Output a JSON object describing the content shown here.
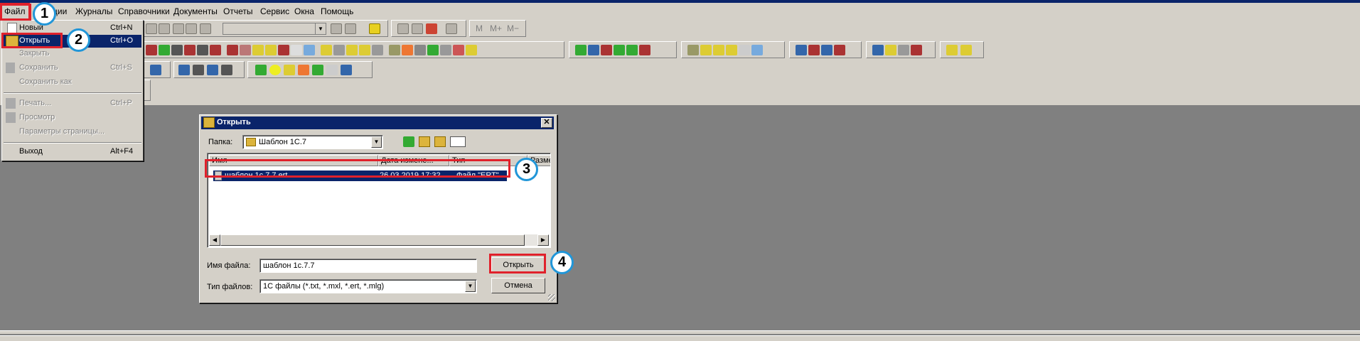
{
  "menubar": {
    "items": [
      "Файл",
      "Операции",
      "Журналы",
      "Справочники",
      "Документы",
      "Отчеты",
      "Сервис",
      "Окна",
      "Помощь"
    ],
    "visible_partial": "ции"
  },
  "toolbar": {
    "text_buttons": [
      "M",
      "M+",
      "M−"
    ]
  },
  "file_menu": {
    "items": [
      {
        "label": "Новый",
        "shortcut": "Ctrl+N",
        "enabled": true
      },
      {
        "label": "Открыть",
        "shortcut": "Ctrl+O",
        "enabled": true,
        "highlighted": true
      },
      {
        "label": "Закрыть",
        "shortcut": "",
        "enabled": false
      },
      {
        "label": "Сохранить",
        "shortcut": "Ctrl+S",
        "enabled": false
      },
      {
        "label": "Сохранить как",
        "shortcut": "",
        "enabled": false
      },
      {
        "label": "Печать...",
        "shortcut": "Ctrl+P",
        "enabled": false
      },
      {
        "label": "Просмотр",
        "shortcut": "",
        "enabled": false
      },
      {
        "label": "Параметры страницы...",
        "shortcut": "",
        "enabled": false
      },
      {
        "label": "Выход",
        "shortcut": "Alt+F4",
        "enabled": true
      }
    ]
  },
  "dialog": {
    "title": "Открыть",
    "close_glyph": "✕",
    "folder_label": "Папка:",
    "folder_value": "Шаблон 1С.7",
    "columns": [
      "Имя",
      "Дата измене...",
      "Тип",
      "Разме"
    ],
    "file": {
      "name": "шаблон 1с.7.7.ert",
      "date": "26.03.2019 17:32",
      "type": "Файл \"ERT\""
    },
    "filename_label": "Имя файла:",
    "filename_value": "шаблон 1с.7.7",
    "filetype_label": "Тип файлов:",
    "filetype_value": "1С файлы (*.txt, *.mxl, *.ert, *.mlg)",
    "open_button": "Открыть",
    "cancel_button": "Отмена"
  },
  "callouts": [
    "1",
    "2",
    "3",
    "4"
  ],
  "colors": {
    "highlight": "#0a246a",
    "face": "#d4d0c8",
    "workspace": "#808080",
    "annotation_red": "#e0212b",
    "annotation_blue": "#2196d8"
  }
}
